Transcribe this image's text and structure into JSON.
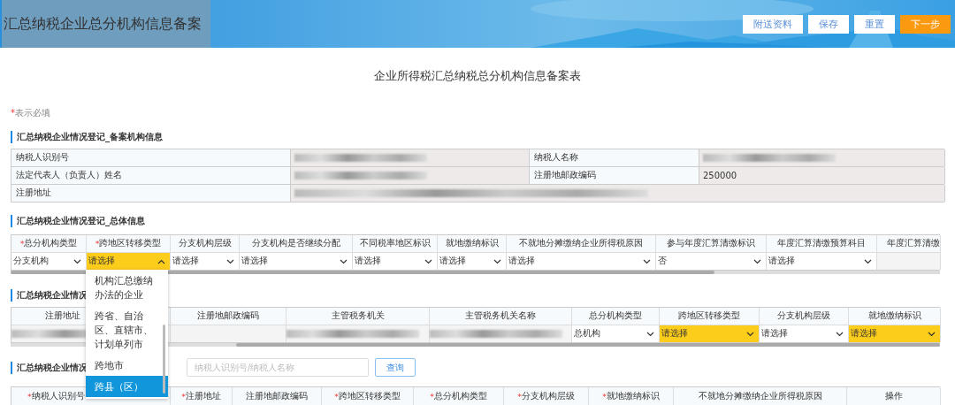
{
  "header": {
    "title": "汇总纳税企业总分机构信息备案",
    "buttons": [
      {
        "label": "附送资料",
        "kind": "default"
      },
      {
        "label": "保存",
        "kind": "default"
      },
      {
        "label": "重置",
        "kind": "default"
      },
      {
        "label": "下一步",
        "kind": "primary"
      }
    ]
  },
  "form_title": "企业所得税汇总纳税总分机构信息备案表",
  "required_note": {
    "marker": "*",
    "text": "表示必填"
  },
  "section_1": {
    "title": "汇总纳税企业情况登记_备案机构信息",
    "rows": [
      {
        "cells": [
          {
            "label": "纳税人识别号",
            "redacted": true
          },
          {
            "label": "纳税人名称",
            "redacted": true
          }
        ]
      },
      {
        "cells": [
          {
            "label": "法定代表人（负责人）姓名",
            "redacted": true
          },
          {
            "label": "注册地邮政编码",
            "redacted": false,
            "value": "250000"
          }
        ]
      },
      {
        "cells": [
          {
            "label": "注册地址",
            "redacted": true
          }
        ]
      }
    ]
  },
  "section_2": {
    "title": "汇总纳税企业情况登记_总体信息",
    "columns": [
      {
        "marker": "*",
        "label": "总分机构类型"
      },
      {
        "marker": "*",
        "label": "跨地区转移类型"
      },
      {
        "label": "分支机构层级"
      },
      {
        "label": "分支机构是否继续分配"
      },
      {
        "label": "不同税率地区标识"
      },
      {
        "label": "就地缴纳标识"
      },
      {
        "label": "不就地分摊缴纳企业所得税原因"
      },
      {
        "label": "参与年度汇算清缴标识"
      },
      {
        "label": "年度汇算清缴预算科目"
      },
      {
        "label": "年度汇算清缴"
      }
    ],
    "row": [
      {
        "kind": "select",
        "value": "分支机构",
        "highlighted": false,
        "open": false
      },
      {
        "kind": "select",
        "value": "请选择",
        "highlighted": true,
        "open": true
      },
      {
        "kind": "select",
        "value": "请选择",
        "highlighted": false,
        "open": false
      },
      {
        "kind": "select",
        "value": "请选择",
        "highlighted": false,
        "open": false
      },
      {
        "kind": "select",
        "value": "请选择",
        "highlighted": false,
        "open": false
      },
      {
        "kind": "select",
        "value": "请选择",
        "highlighted": false,
        "open": false
      },
      {
        "kind": "select",
        "value": "请选择",
        "highlighted": false,
        "open": false
      },
      {
        "kind": "select",
        "value": "否",
        "highlighted": false,
        "open": false
      },
      {
        "kind": "select",
        "value": "请选择",
        "highlighted": false,
        "open": false
      },
      {
        "kind": "blank"
      }
    ]
  },
  "section_3": {
    "title": "汇总纳税企业情况",
    "columns": [
      {
        "label": "注册地址"
      },
      {
        "label": "注册地邮政编码"
      },
      {
        "label": "主管税务机关"
      },
      {
        "label": "主管税务机关名称"
      },
      {
        "label": "总分机构类型"
      },
      {
        "label": "跨地区转移类型"
      },
      {
        "label": "分支机构层级"
      },
      {
        "label": "就地缴纳标识"
      }
    ],
    "row": [
      {
        "kind": "redacted"
      },
      {
        "kind": "blank"
      },
      {
        "kind": "redacted"
      },
      {
        "kind": "redacted"
      },
      {
        "kind": "select",
        "value": "总机构",
        "highlighted": false,
        "open": false
      },
      {
        "kind": "select",
        "value": "请选择",
        "highlighted": true,
        "open": false
      },
      {
        "kind": "select",
        "value": "请选择",
        "highlighted": false,
        "open": false
      },
      {
        "kind": "select",
        "value": "请选择",
        "highlighted": true,
        "open": false
      }
    ]
  },
  "section_4": {
    "title": "汇总纳税企业情况",
    "search": {
      "placeholder": "纳税人识别号/纳税人名称",
      "button": "查询"
    },
    "columns": [
      {
        "marker": "*",
        "label": "纳税人识别号"
      },
      {
        "marker": "*",
        "label": "注册地址"
      },
      {
        "label": "注册地邮政编码"
      },
      {
        "marker": "*",
        "label": "跨地区转移类型"
      },
      {
        "marker": "*",
        "label": "总分机构类型"
      },
      {
        "marker": "*",
        "label": "分支机构层级"
      },
      {
        "marker": "*",
        "label": "就地缴纳标识"
      },
      {
        "label": "不就地分摊缴纳企业所得税原因"
      },
      {
        "label": "操作"
      }
    ]
  },
  "dropdown": {
    "options": [
      {
        "label": "机构汇总缴纳办法的企业",
        "selected": false
      },
      {
        "label": "跨省、自治区、直辖市、计划单列市",
        "selected": false
      },
      {
        "label": "跨地市",
        "selected": false
      },
      {
        "label": "跨县（区）",
        "selected": true
      }
    ]
  }
}
